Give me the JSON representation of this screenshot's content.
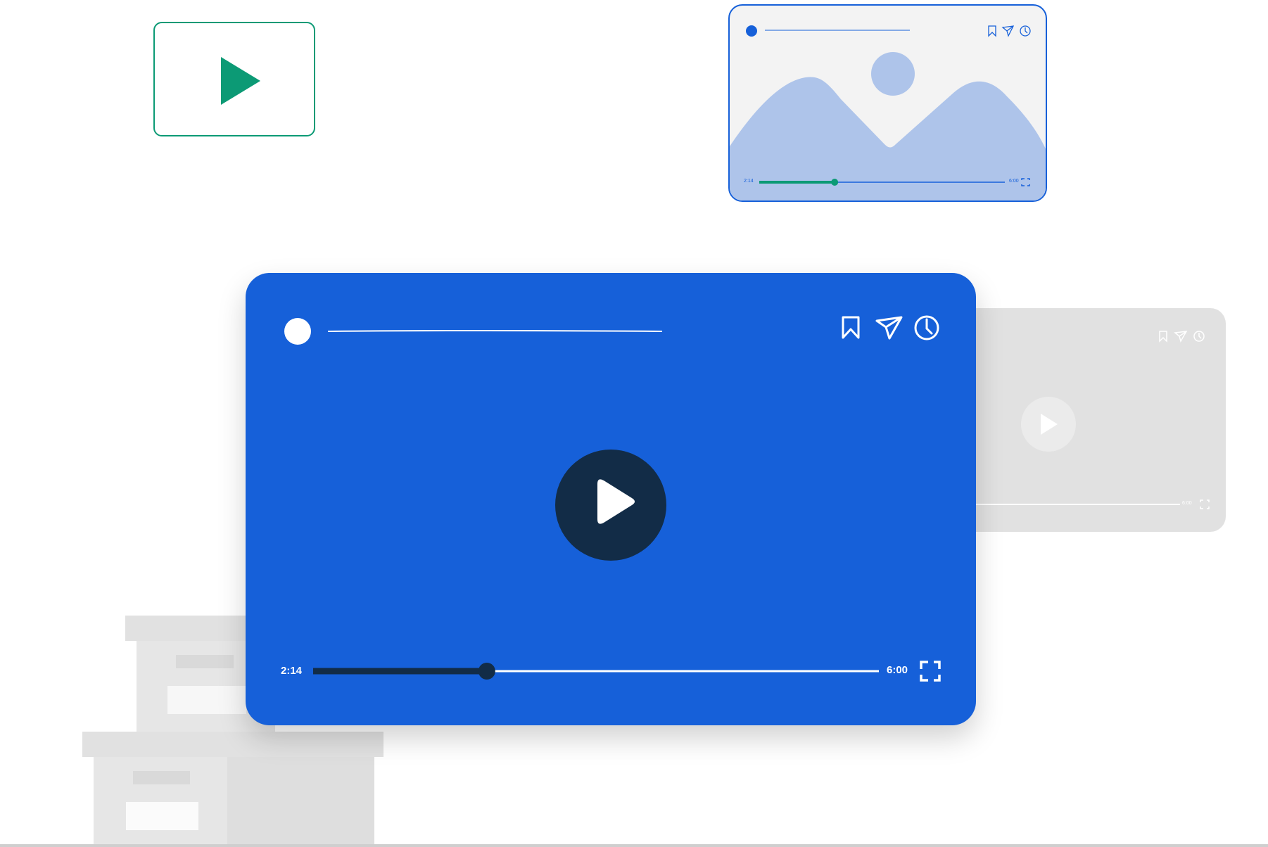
{
  "colors": {
    "primary_blue": "#1660d9",
    "dark_navy": "#122c47",
    "green": "#0c9a75",
    "light_blue": "#aec4ea",
    "ghost_gray": "#e1e1e1"
  },
  "main_player": {
    "current_time": "2:14",
    "total_time": "6:00",
    "progress": 0.307,
    "icons": [
      "bookmark-icon",
      "send-icon",
      "clock-icon",
      "play-icon",
      "fullscreen-icon"
    ]
  },
  "image_player": {
    "current_time": "2:14",
    "total_time": "6:00",
    "progress": 0.307
  },
  "ghost_player": {
    "total_time": "6:00"
  },
  "thumb_card": {
    "icon": "play-icon"
  }
}
